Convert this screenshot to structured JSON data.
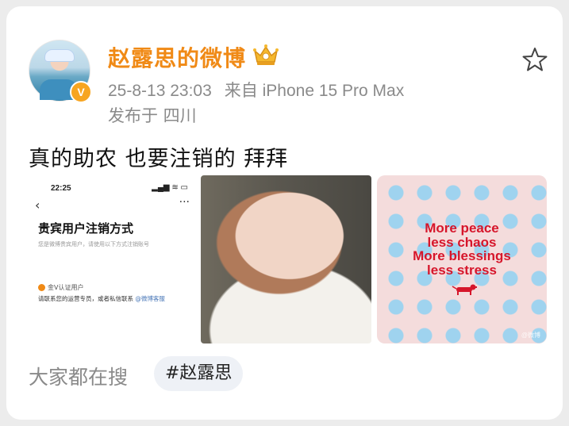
{
  "post": {
    "username": "赵露思的微博",
    "timestamp": "25-8-13 23:03",
    "source": "来自 iPhone 15 Pro Max",
    "location": "发布于 四川",
    "text": "真的助农 也要注销的 拜拜",
    "verified_badge": "V",
    "icons": [
      "crown-icon",
      "star-icon",
      "verified-badge"
    ],
    "accent_color": "#f08a16"
  },
  "images": {
    "screenshot": {
      "time": "22:25",
      "status": "▂▄▆ ≋ ▭",
      "back": "‹",
      "more": "···",
      "title": "贵宾用户注销方式",
      "subtitle": "您是微博贵宾用户，请使用以下方式注销账号",
      "badge_label": "金V认证用户",
      "contact_prefix": "请联系您的运营专员，或者私信联系 ",
      "contact_link": "@微博客服"
    },
    "quote": {
      "line1": "More peace",
      "line2": "less chaos",
      "line3": "More blessings",
      "line4": "less stress",
      "watermark": "@微博"
    }
  },
  "footer": {
    "search_label": "大家都在搜",
    "tag": "#赵露思"
  }
}
